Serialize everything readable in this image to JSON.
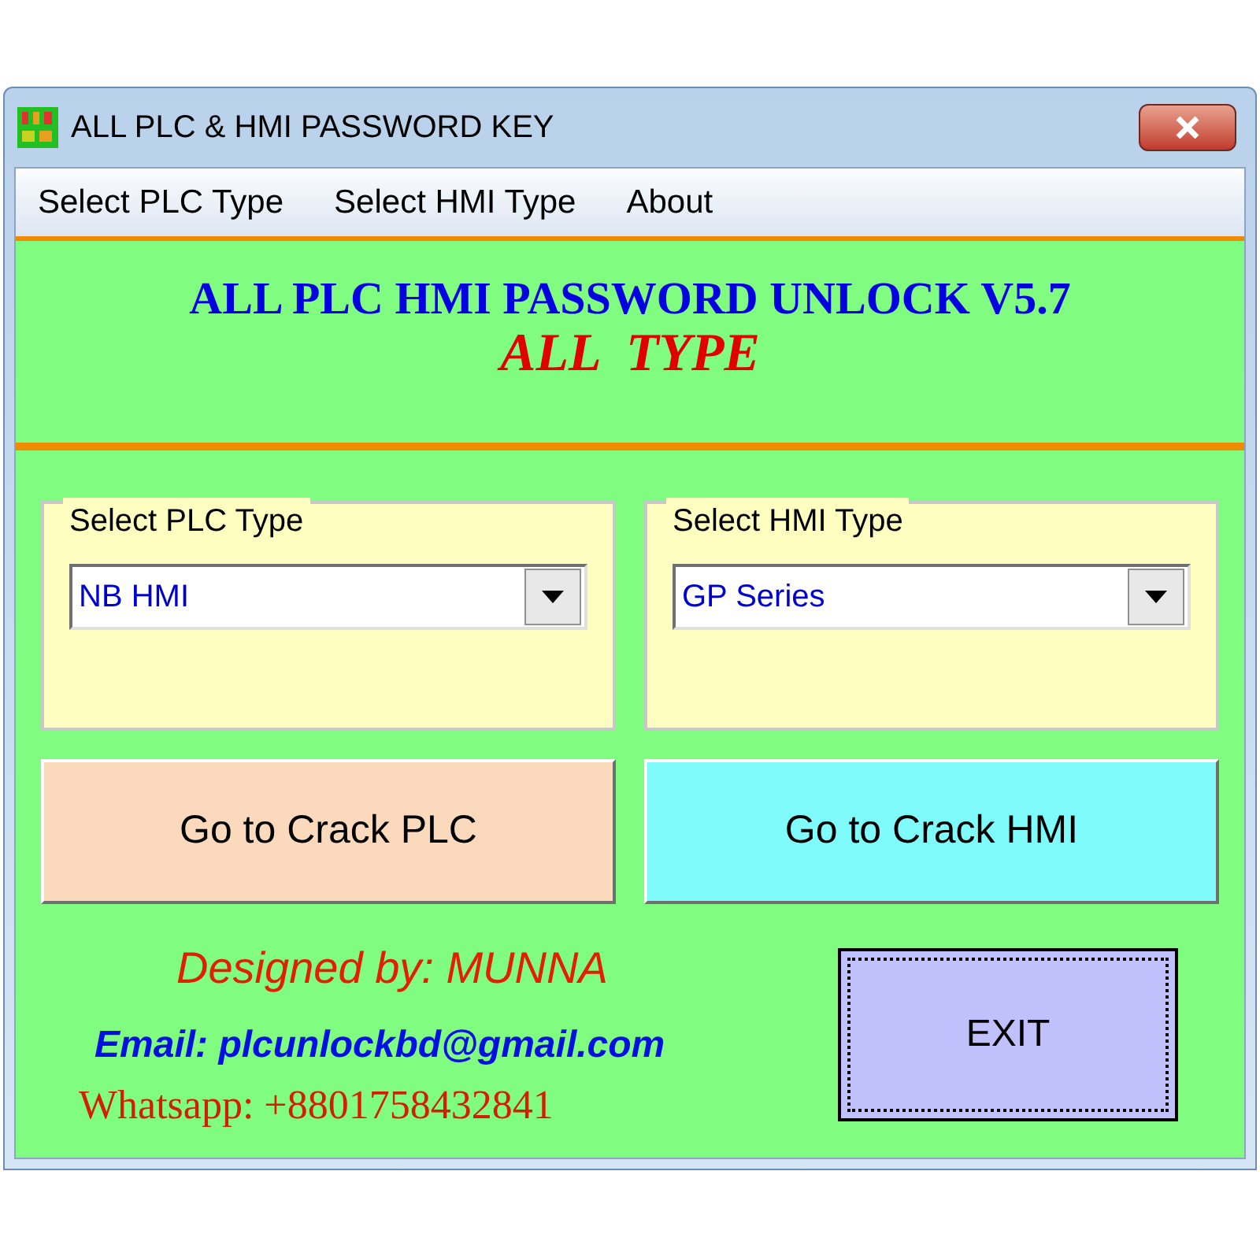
{
  "window": {
    "title": "ALL PLC & HMI PASSWORD KEY"
  },
  "menu": [
    {
      "label": "Select PLC Type"
    },
    {
      "label": "Select HMI Type"
    },
    {
      "label": "About"
    }
  ],
  "heading": {
    "title": "ALL PLC HMI PASSWORD UNLOCK V5.7",
    "subtitle": "ALL  TYPE"
  },
  "groups": [
    {
      "label": "Select PLC Type",
      "value": "NB HMI"
    },
    {
      "label": "Select HMI Type",
      "value": "GP Series"
    }
  ],
  "crack_buttons": [
    {
      "label": "Go to Crack PLC",
      "color": "#fbd9bd"
    },
    {
      "label": "Go to Crack HMI",
      "color": "#80fbfb"
    }
  ],
  "credits": {
    "designer": "Designed by: MUNNA",
    "email": "Email: plcunlockbd@gmail.com",
    "whatsapp": "Whatsapp: +8801758432841"
  },
  "exit_button": {
    "label": "EXIT",
    "focused": true
  }
}
